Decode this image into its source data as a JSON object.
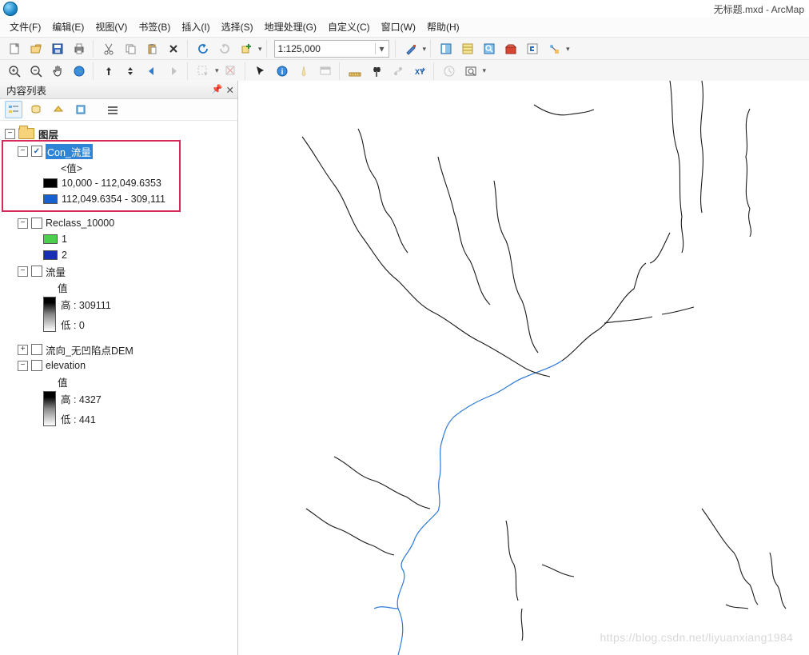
{
  "window": {
    "title": "无标题.mxd - ArcMap"
  },
  "menu": {
    "file": "文件(F)",
    "edit": "编辑(E)",
    "view": "视图(V)",
    "bookmarks": "书签(B)",
    "insert": "插入(I)",
    "select": "选择(S)",
    "geoprocessing": "地理处理(G)",
    "customize": "自定义(C)",
    "window": "窗口(W)",
    "help": "帮助(H)"
  },
  "toolbar": {
    "scale": "1:125,000"
  },
  "toc": {
    "title": "内容列表",
    "root": "图层",
    "layers": {
      "con": {
        "name": "Con_流量",
        "value_header": "<值>",
        "classes": [
          {
            "label": "10,000 - 112,049.6353",
            "color": "black"
          },
          {
            "label": "112,049.6354 - 309,111",
            "color": "blue"
          }
        ]
      },
      "reclass": {
        "name": "Reclass_10000",
        "classes": [
          {
            "label": "1",
            "color": "green"
          },
          {
            "label": "2",
            "color": "dblue"
          }
        ]
      },
      "flow": {
        "name": "流量",
        "value_header": "值",
        "high_prefix": "高 : ",
        "high": "309111",
        "low_prefix": "低 : ",
        "low": "0"
      },
      "dem": {
        "name": "流向_无凹陷点DEM"
      },
      "elev": {
        "name": "elevation",
        "value_header": "值",
        "high_prefix": "高 : ",
        "high": "4327",
        "low_prefix": "低 : ",
        "low": "441"
      }
    }
  },
  "watermark": "https://blog.csdn.net/liyuanxiang1984"
}
